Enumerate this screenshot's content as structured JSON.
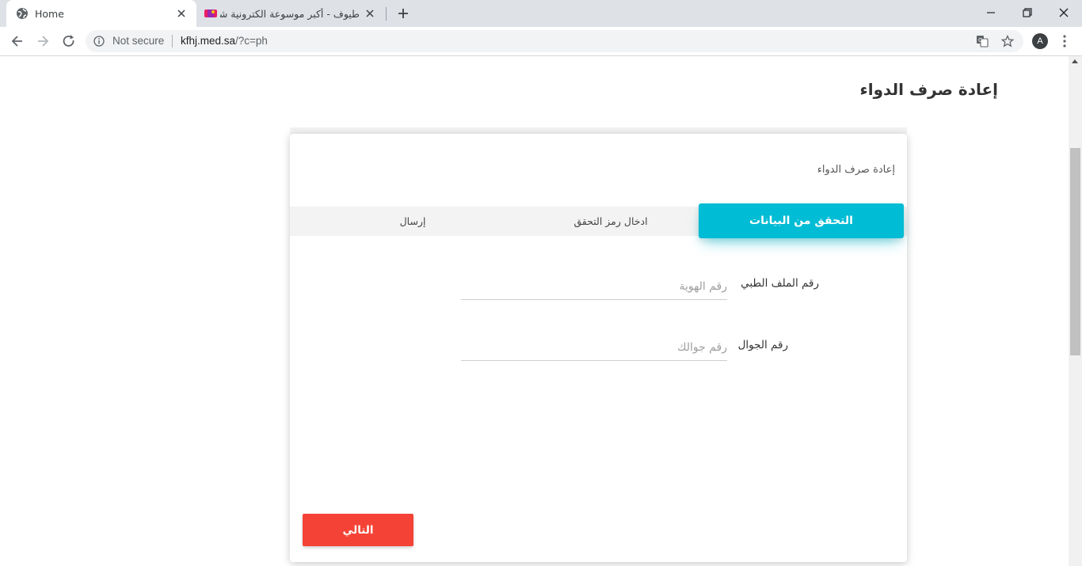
{
  "browser": {
    "tabs": [
      {
        "title": "Home",
        "active": true
      },
      {
        "title": "طيوف - أكبر موسوعة الكترونية شاملة",
        "active": false
      }
    ],
    "security_label": "Not secure",
    "url_host": "kfhj.med.sa",
    "url_path": "/?c=ph",
    "profile_initial": "A"
  },
  "page": {
    "title": "إعادة صرف الدواء",
    "card": {
      "heading": "إعادة صرف الدواء",
      "steps": [
        {
          "label": "التحقق من البيانات",
          "active": true
        },
        {
          "label": "ادخال رمز التحقق",
          "active": false
        },
        {
          "label": "إرسال",
          "active": false
        }
      ],
      "fields": {
        "medical_file": {
          "label": "رقم الملف الطبي",
          "placeholder": "رقم الهوية",
          "value": ""
        },
        "mobile": {
          "label": "رقم الجوال",
          "placeholder": "رقم جوالك",
          "value": ""
        }
      },
      "next_button": "التالي"
    }
  },
  "colors": {
    "step_active": "#00bcd4",
    "next_button": "#f44336",
    "tabstrip": "#dee1e6"
  }
}
